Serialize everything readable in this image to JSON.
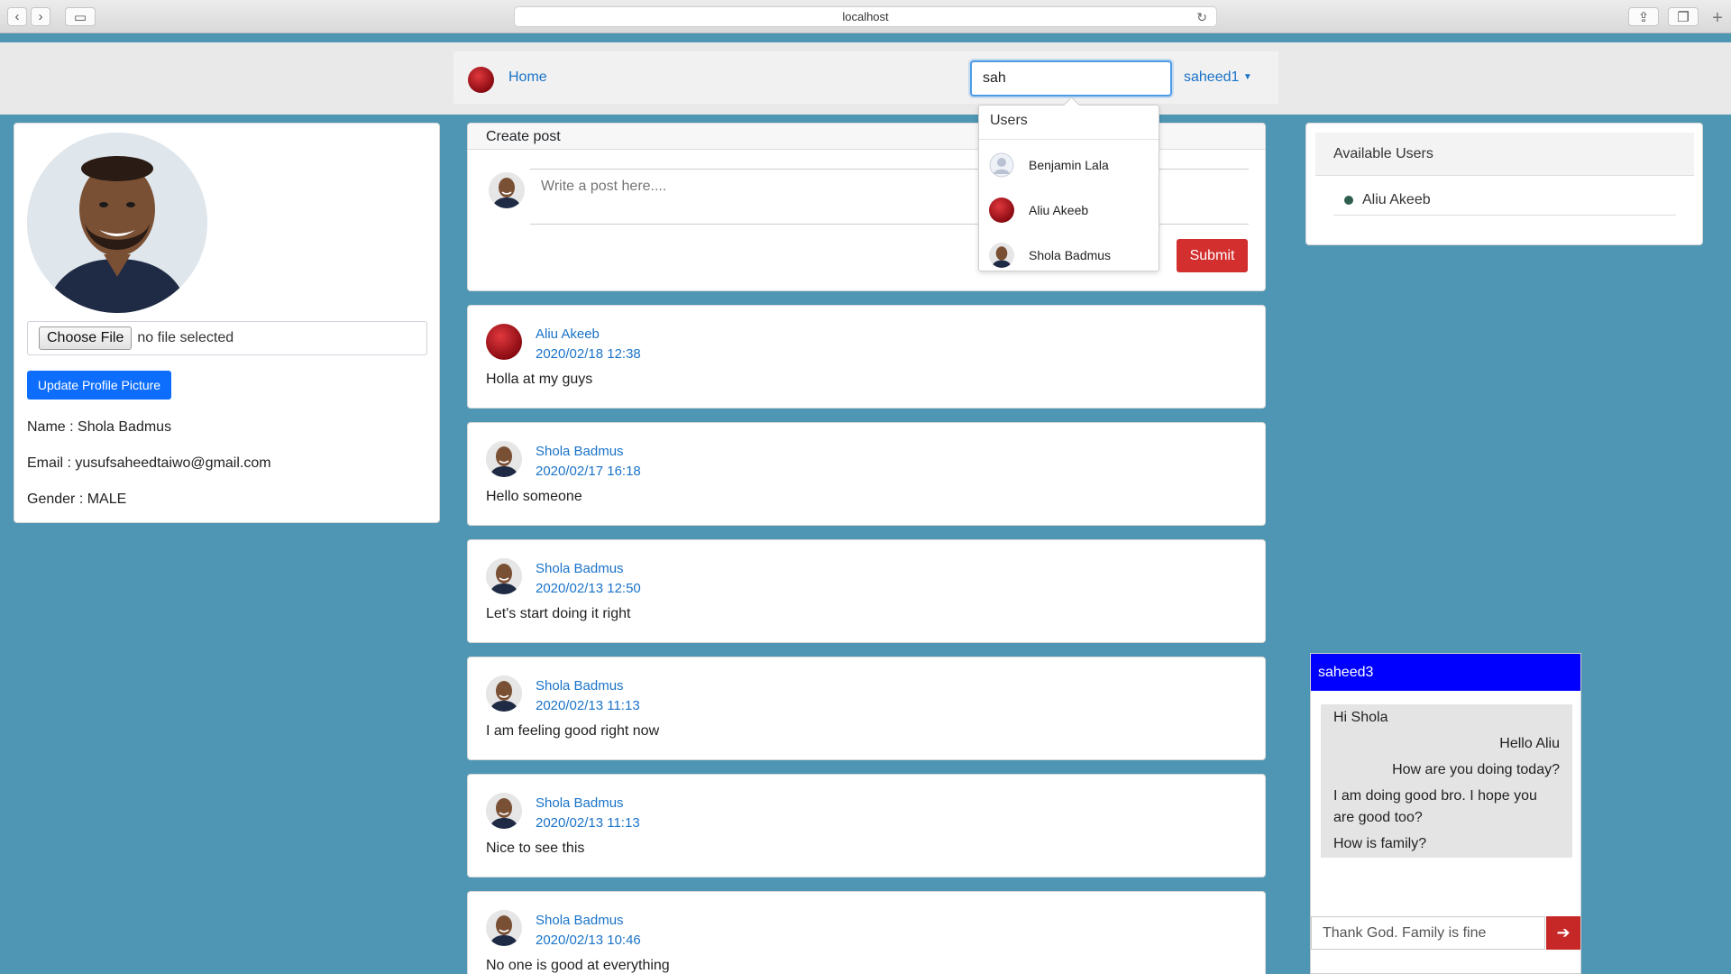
{
  "browser": {
    "url": "localhost"
  },
  "navbar": {
    "home_label": "Home",
    "search_value": "sah",
    "user_menu_label": "saheed1"
  },
  "search_dropdown": {
    "heading": "Users",
    "items": [
      {
        "name": "Benjamin Lala",
        "avatar": "default-avatar-icon"
      },
      {
        "name": "Aliu Akeeb",
        "avatar": "red-circle-avatar"
      },
      {
        "name": "Shola Badmus",
        "avatar": "photo-avatar"
      }
    ]
  },
  "profile": {
    "file_button_label": "Choose File",
    "file_status": "no file selected",
    "update_button_label": "Update Profile Picture",
    "name_line": "Name : Shola Badmus",
    "email_line": "Email : yusufsaheedtaiwo@gmail.com",
    "gender_line": "Gender : MALE"
  },
  "create_post": {
    "header": "Create post",
    "placeholder": "Write a post here....",
    "submit_label": "Submit"
  },
  "posts": [
    {
      "author": "Aliu Akeeb",
      "date": "2020/02/18 12:38",
      "text": "Holla at my guys",
      "avatar": "red-circle-avatar"
    },
    {
      "author": "Shola Badmus",
      "date": "2020/02/17 16:18",
      "text": "Hello someone",
      "avatar": "photo-avatar"
    },
    {
      "author": "Shola Badmus",
      "date": "2020/02/13 12:50",
      "text": "Let's start doing it right",
      "avatar": "photo-avatar"
    },
    {
      "author": "Shola Badmus",
      "date": "2020/02/13 11:13",
      "text": "I am feeling good right now",
      "avatar": "photo-avatar"
    },
    {
      "author": "Shola Badmus",
      "date": "2020/02/13 11:13",
      "text": "Nice to see this",
      "avatar": "photo-avatar"
    },
    {
      "author": "Shola Badmus",
      "date": "2020/02/13 10:46",
      "text": "No one is good at everything",
      "avatar": "photo-avatar"
    }
  ],
  "available_users": {
    "header": "Available Users",
    "users": [
      "Aliu Akeeb"
    ]
  },
  "chat": {
    "title": "saheed3",
    "messages": [
      {
        "text": "Hi Shola",
        "side": "left"
      },
      {
        "text": "Hello Aliu",
        "side": "right"
      },
      {
        "text": "How are you doing today?",
        "side": "right"
      },
      {
        "text": "I am doing good bro. I hope you are good too?",
        "side": "left"
      },
      {
        "text": "How is family?",
        "side": "left"
      }
    ],
    "input_value": "Thank God. Family is fine"
  },
  "colors": {
    "page_bg": "#4e96b3",
    "primary": "#0d6efd",
    "link": "#1a73c8",
    "danger": "#d32f2f",
    "chat_header": "#0000ff"
  }
}
